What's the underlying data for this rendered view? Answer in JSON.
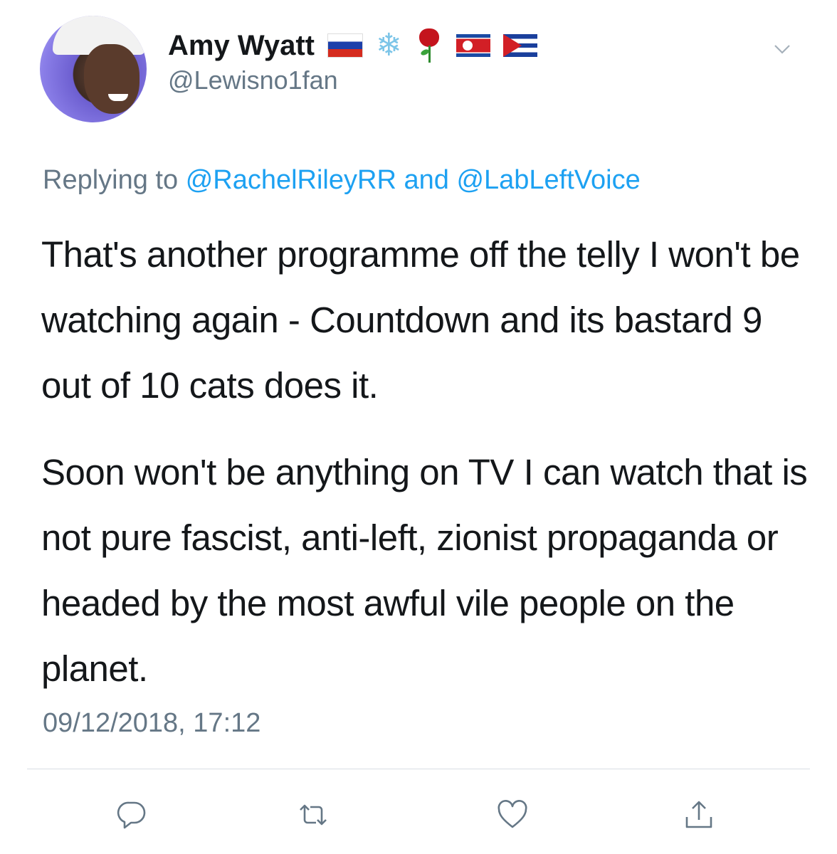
{
  "author": {
    "display_name": "Amy Wyatt",
    "handle": "@Lewisno1fan",
    "name_emojis": [
      "russia-flag",
      "snowflake",
      "rose",
      "north-korea-flag",
      "cuba-flag"
    ]
  },
  "reply": {
    "prefix": "Replying to",
    "mention_1": "@RachelRileyRR",
    "joiner": "and",
    "mention_2": "@LabLeftVoice"
  },
  "tweet": {
    "paragraph_1": "That's another programme off the telly I won't be watching again - Countdown and its bastard 9 out of 10 cats does it.",
    "paragraph_2": "Soon won't be anything on TV I can watch that is not pure fascist, anti-left, zionist propaganda or headed by the most awful vile people on the planet.",
    "timestamp": "09/12/2018, 17:12"
  },
  "actions": [
    "reply-icon",
    "retweet-icon",
    "like-icon",
    "share-icon"
  ],
  "colors": {
    "text": "#14171a",
    "secondary": "#657786",
    "link": "#1da1f2",
    "divider": "#d8dee3"
  }
}
